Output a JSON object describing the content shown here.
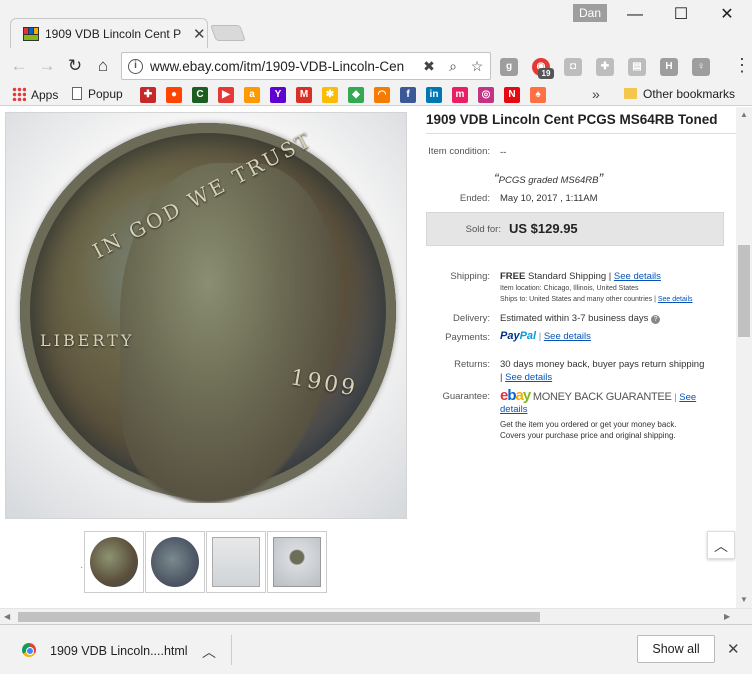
{
  "window": {
    "tab_title": "1909 VDB Lincoln Cent P",
    "user_name": "Dan",
    "min_symbol": "—",
    "max_symbol": "☐",
    "close_symbol": "✕"
  },
  "toolbar": {
    "url": "www.ebay.com/itm/1909-VDB-Lincoln-Cen",
    "extension_badge": "19"
  },
  "bookmarks": {
    "apps_label": "Apps",
    "popup_label": "Popup",
    "overflow": "»",
    "other_label": "Other bookmarks",
    "sites": [
      {
        "icon": "pin-icon",
        "glyph": "✚",
        "color": "#c62828"
      },
      {
        "icon": "reddit-icon",
        "glyph": "●",
        "color": "#ff4500"
      },
      {
        "icon": "c-icon",
        "glyph": "C",
        "color": "#1b5e20"
      },
      {
        "icon": "youtube-icon",
        "glyph": "▶",
        "color": "#e53935"
      },
      {
        "icon": "amazon-icon",
        "glyph": "a",
        "color": "#ff9900"
      },
      {
        "icon": "yahoo-icon",
        "glyph": "Y",
        "color": "#5f01d1"
      },
      {
        "icon": "gmail-icon",
        "glyph": "M",
        "color": "#d93025"
      },
      {
        "icon": "photos-icon",
        "glyph": "✱",
        "color": "#fbbc04"
      },
      {
        "icon": "maps-icon",
        "glyph": "◆",
        "color": "#34a853"
      },
      {
        "icon": "headphones-icon",
        "glyph": "◠",
        "color": "#f57c00"
      },
      {
        "icon": "facebook-icon",
        "glyph": "f",
        "color": "#3b5998"
      },
      {
        "icon": "linkedin-icon",
        "glyph": "in",
        "color": "#0077b5"
      },
      {
        "icon": "m-icon",
        "glyph": "m",
        "color": "#e91e63"
      },
      {
        "icon": "instagram-icon",
        "glyph": "◎",
        "color": "#c13584"
      },
      {
        "icon": "netflix-icon",
        "glyph": "N",
        "color": "#e50914"
      },
      {
        "icon": "puzzle-icon",
        "glyph": "♠",
        "color": "#ff7043"
      }
    ]
  },
  "listing": {
    "title": "1909 VDB Lincoln Cent PCGS MS64RB Toned",
    "condition_label": "Item condition:",
    "condition_value": "--",
    "condition_quote": "PCGS graded MS64RB",
    "ended_label": "Ended:",
    "ended_value": "May 10, 2017 , 1:11AM",
    "sold_label": "Sold for:",
    "sold_value": "US $129.95",
    "shipping_label": "Shipping:",
    "shipping_free": "FREE",
    "shipping_method": "Standard Shipping |",
    "see_details": "See details",
    "item_location": "Item location:  Chicago, Illinois, United States",
    "ships_to": "Ships to:  United States and many other countries |",
    "delivery_label": "Delivery:",
    "delivery_value": "Estimated within 3-7 business days",
    "payments_label": "Payments:",
    "paypal_a": "Pay",
    "paypal_b": "Pal",
    "returns_label": "Returns:",
    "returns_value": "30 days money back, buyer pays return shipping",
    "guarantee_label": "Guarantee:",
    "mbg_text": "MONEY BACK GUARANTEE",
    "see": "See",
    "details": "details",
    "guarantee_note_1": "Get the item you ordered or get your money back.",
    "guarantee_note_2": "Covers your purchase price and original shipping."
  },
  "coin": {
    "motto": "IN GOD WE TRUST",
    "liberty": "LIBERTY",
    "year": "1909"
  },
  "download": {
    "filename": "1909 VDB Lincoln....html",
    "show_all": "Show all"
  }
}
